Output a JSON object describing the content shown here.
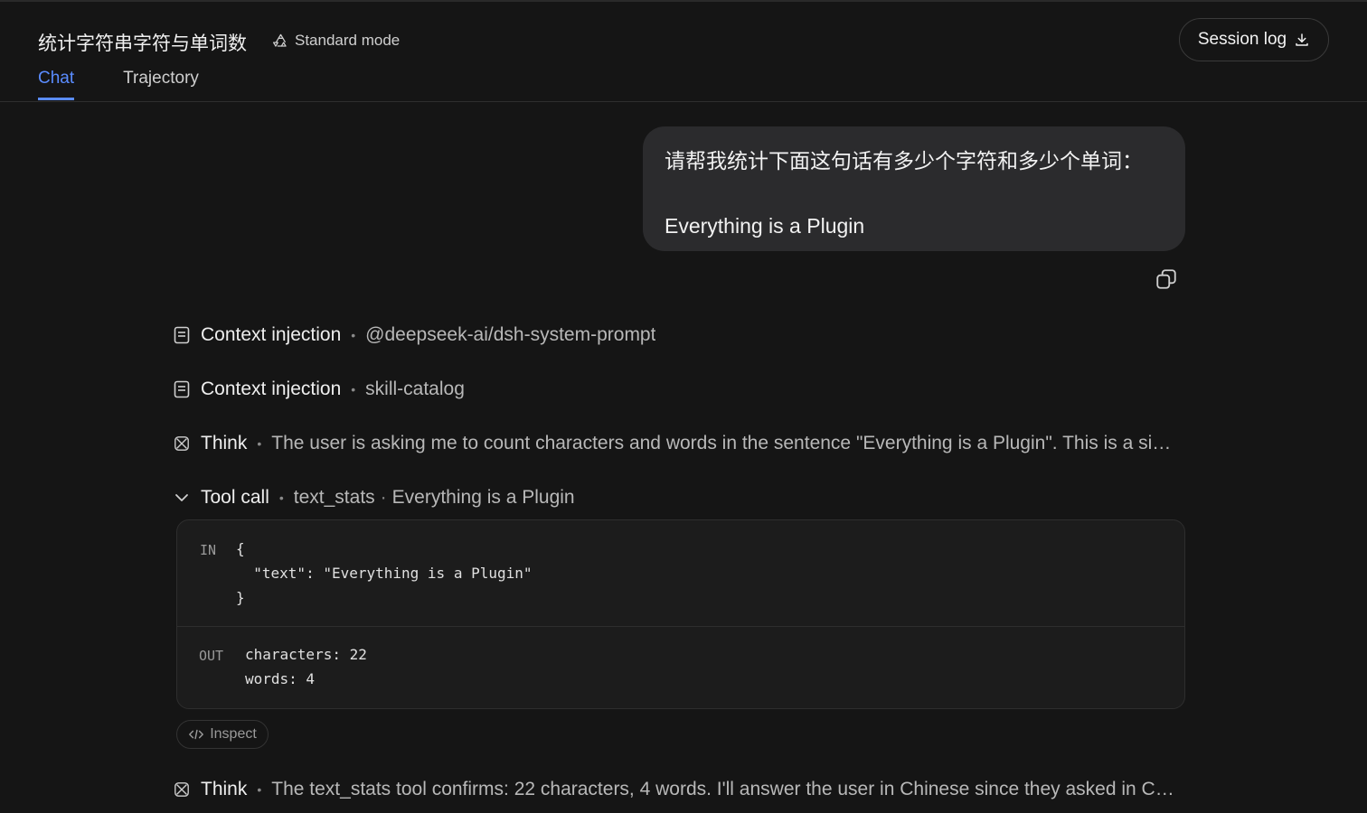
{
  "header": {
    "title": "统计字符串字符与单词数",
    "mode_label": "Standard mode",
    "session_log_label": "Session log"
  },
  "tabs": [
    {
      "label": "Chat",
      "active": true
    },
    {
      "label": "Trajectory",
      "active": false
    }
  ],
  "user_message": {
    "line1": "请帮我统计下面这句话有多少个字符和多少个单词：",
    "line2": "Everything is a Plugin"
  },
  "trajectory": {
    "context1": {
      "label": "Context injection",
      "detail": "@deepseek-ai/dsh-system-prompt"
    },
    "context2": {
      "label": "Context injection",
      "detail": "skill-catalog"
    },
    "think1": {
      "label": "Think",
      "detail": "The user is asking me to count characters and words in the sentence \"Everything is a Plugin\". This is a simpl..."
    },
    "tool_call": {
      "label": "Tool call",
      "tool_name": "text_stats",
      "sep": "·",
      "arg": "Everything is a Plugin",
      "in_label": "IN",
      "in_code": "{\n  \"text\": \"Everything is a Plugin\"\n}",
      "out_label": "OUT",
      "out_code": "characters: 22\nwords: 4"
    },
    "inspect_label": "Inspect",
    "think2": {
      "label": "Think",
      "detail": "The text_stats tool confirms: 22 characters, 4 words. I'll answer the user in Chinese since they asked in Chine..."
    }
  },
  "colors": {
    "background": "#151515",
    "accent": "#5a8cff",
    "bubble": "#2b2b2d"
  }
}
